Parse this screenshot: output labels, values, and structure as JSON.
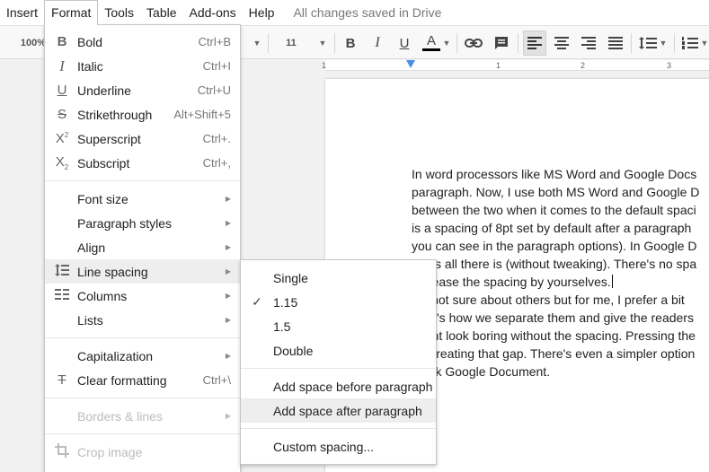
{
  "menubar": {
    "items": [
      "Insert",
      "Format",
      "Tools",
      "Table",
      "Add-ons",
      "Help"
    ],
    "status": "All changes saved in Drive"
  },
  "toolbar": {
    "zoom": "100%",
    "font_size": "11"
  },
  "ruler": {
    "numbers": [
      "1",
      "1",
      "2",
      "3"
    ]
  },
  "format_menu": {
    "items": [
      {
        "label": "Bold",
        "shortcut": "Ctrl+B",
        "icon": "bold-icon"
      },
      {
        "label": "Italic",
        "shortcut": "Ctrl+I",
        "icon": "italic-icon"
      },
      {
        "label": "Underline",
        "shortcut": "Ctrl+U",
        "icon": "underline-icon"
      },
      {
        "label": "Strikethrough",
        "shortcut": "Alt+Shift+5",
        "icon": "strikethrough-icon"
      },
      {
        "label": "Superscript",
        "shortcut": "Ctrl+.",
        "icon": "superscript-icon"
      },
      {
        "label": "Subscript",
        "shortcut": "Ctrl+,",
        "icon": "subscript-icon"
      },
      {
        "label": "Font size"
      },
      {
        "label": "Paragraph styles"
      },
      {
        "label": "Align"
      },
      {
        "label": "Line spacing",
        "icon": "line-spacing-icon"
      },
      {
        "label": "Columns",
        "icon": "columns-icon"
      },
      {
        "label": "Lists"
      },
      {
        "label": "Capitalization"
      },
      {
        "label": "Clear formatting",
        "shortcut": "Ctrl+\\",
        "icon": "clear-formatting-icon"
      },
      {
        "label": "Borders & lines"
      },
      {
        "label": "Crop image",
        "icon": "crop-icon"
      }
    ]
  },
  "line_spacing_menu": {
    "items": [
      {
        "label": "Single"
      },
      {
        "label": "1.15",
        "checked": true
      },
      {
        "label": "1.5"
      },
      {
        "label": "Double"
      },
      {
        "label": "Add space before paragraph"
      },
      {
        "label": "Add space after paragraph"
      },
      {
        "label": "Custom spacing..."
      }
    ]
  },
  "document": {
    "lines": [
      "In word processors like MS Word and Google Docs",
      "paragraph. Now, I use both MS Word and Google D",
      "between the two when it comes to the default spaci",
      "is a spacing of 8pt set by default after a paragraph",
      "you can see in the paragraph options). In Google D",
      "that's all there is (without tweaking). There's no spa",
      "increase the spacing by yourselves.",
      "I'm not sure about others but for me, I prefer a bit",
      "That's how we separate them and give the readers",
      "might look boring without the spacing. Pressing the",
      "for creating that gap. There's even a simpler option",
      "blank Google Document."
    ]
  },
  "colors": {
    "accent": "#4a90e2",
    "text_color_bar": "#000000"
  }
}
